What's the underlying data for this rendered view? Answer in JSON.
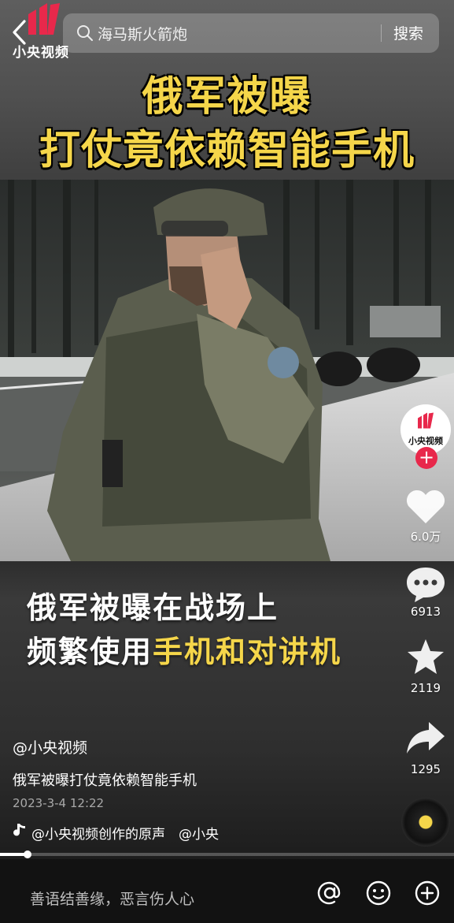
{
  "top": {
    "back_icon": "chevron-left-icon",
    "logo_text": "小央视频",
    "search_placeholder": "海马斯火箭炮",
    "search_button": "搜索"
  },
  "headline": {
    "line1": "俄军被曝",
    "line2": "打仗竟依赖智能手机"
  },
  "caption": {
    "line1": "俄军被曝在战场上",
    "line2_prefix": "频繁使用",
    "line2_highlight": "手机和对讲机"
  },
  "rail": {
    "avatar_label": "小央视频",
    "likes": "6.0万",
    "comments": "6913",
    "favorites": "2119",
    "shares": "1295"
  },
  "post": {
    "author": "@小央视频",
    "description": "俄军被曝打仗竟依赖智能手机",
    "datetime": "2023-3-4 12:22",
    "music": "@小央视频创作的原声　@小央"
  },
  "playback": {
    "progress": 0.06
  },
  "bottom": {
    "comment_placeholder": "善语结善缘，恶言伤人心"
  },
  "colors": {
    "accent_yellow": "#f5d64a",
    "brand_red": "#e8284b"
  }
}
